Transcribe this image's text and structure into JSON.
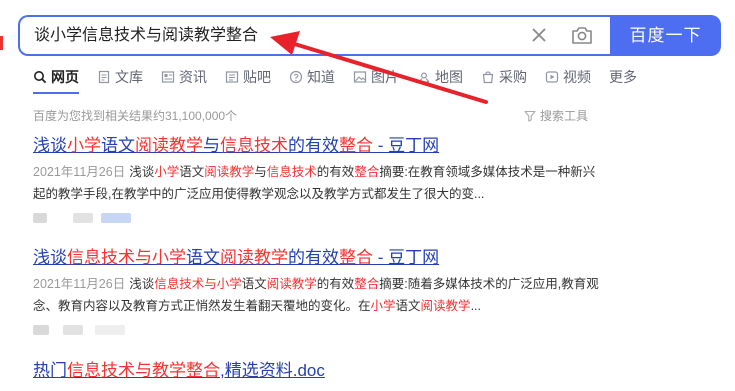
{
  "search": {
    "query": "谈小学信息技术与阅读教学整合",
    "button_label": "百度一下"
  },
  "tabs": [
    {
      "label": "网页",
      "icon": "search-icon",
      "active": true
    },
    {
      "label": "文库",
      "icon": "document-icon"
    },
    {
      "label": "资讯",
      "icon": "news-icon"
    },
    {
      "label": "贴吧",
      "icon": "tieba-icon"
    },
    {
      "label": "知道",
      "icon": "question-icon"
    },
    {
      "label": "图片",
      "icon": "image-icon"
    },
    {
      "label": "地图",
      "icon": "map-pin-icon"
    },
    {
      "label": "采购",
      "icon": "shopping-bag-icon"
    },
    {
      "label": "视频",
      "icon": "play-icon"
    },
    {
      "label": "更多"
    }
  ],
  "result_count": "百度为您找到相关结果约31,100,000个",
  "search_tools_label": "搜索工具",
  "results": [
    {
      "title_parts": [
        {
          "text": "浅谈",
          "hl": false
        },
        {
          "text": "小学",
          "hl": true
        },
        {
          "text": "语文",
          "hl": false
        },
        {
          "text": "阅读教学",
          "hl": true
        },
        {
          "text": "与",
          "hl": false
        },
        {
          "text": "信息技术",
          "hl": true
        },
        {
          "text": "的有效",
          "hl": false
        },
        {
          "text": "整合",
          "hl": true
        },
        {
          "text": " - 豆丁网",
          "hl": false
        }
      ],
      "date": "2021年11月26日",
      "abstract_parts": [
        {
          "text": "浅谈",
          "hl": false
        },
        {
          "text": "小学",
          "hl": true
        },
        {
          "text": "语文",
          "hl": false
        },
        {
          "text": "阅读教学",
          "hl": true
        },
        {
          "text": "与",
          "hl": false
        },
        {
          "text": "信息技术",
          "hl": true
        },
        {
          "text": "的有效",
          "hl": false
        },
        {
          "text": "整合",
          "hl": true
        },
        {
          "text": "摘要:在教育领域多媒体技术是一种新兴起的教学手段,在教学中的广泛应用使得教学观念以及教学方式都发生了很大的变...",
          "hl": false
        }
      ]
    },
    {
      "title_parts": [
        {
          "text": "浅谈",
          "hl": false
        },
        {
          "text": "信息技术与小学",
          "hl": true
        },
        {
          "text": "语文",
          "hl": false
        },
        {
          "text": "阅读教学",
          "hl": true
        },
        {
          "text": "的有效",
          "hl": false
        },
        {
          "text": "整合",
          "hl": true
        },
        {
          "text": " - 豆丁网",
          "hl": false
        }
      ],
      "date": "2021年11月26日",
      "abstract_parts": [
        {
          "text": "浅谈",
          "hl": false
        },
        {
          "text": "信息技术与小学",
          "hl": true
        },
        {
          "text": "语文",
          "hl": false
        },
        {
          "text": "阅读教学",
          "hl": true
        },
        {
          "text": "的有效",
          "hl": false
        },
        {
          "text": "整合",
          "hl": true
        },
        {
          "text": "摘要:随着多媒体技术的广泛应用,教育观念、教育内容以及教育方式正悄然发生着翻天覆地的变化。在",
          "hl": false
        },
        {
          "text": "小学",
          "hl": true
        },
        {
          "text": "语文",
          "hl": false
        },
        {
          "text": "阅读教学",
          "hl": true
        },
        {
          "text": "...",
          "hl": false
        }
      ]
    },
    {
      "title_parts": [
        {
          "text": "热门",
          "hl": false
        },
        {
          "text": "信息技术与教学整合",
          "hl": true
        },
        {
          "text": ",精选资料.doc",
          "hl": false
        }
      ]
    }
  ],
  "colors": {
    "brand": "#4e6ef2",
    "link": "#2440b3",
    "highlight": "#f73131",
    "annotation_arrow": "#e8222a"
  }
}
